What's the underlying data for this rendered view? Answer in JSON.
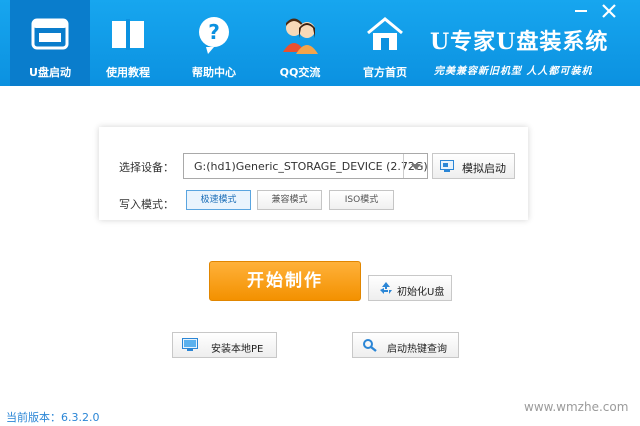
{
  "header": {
    "nav": [
      {
        "label": "U盘启动",
        "icon": "usb-window-icon",
        "active": true
      },
      {
        "label": "使用教程",
        "icon": "book-icon",
        "active": false
      },
      {
        "label": "帮助中心",
        "icon": "help-icon",
        "active": false
      },
      {
        "label": "QQ交流",
        "icon": "qq-users-icon",
        "active": false
      },
      {
        "label": "官方首页",
        "icon": "home-icon",
        "active": false
      }
    ],
    "brand": "U专家U盘装系统",
    "slogan": "完美兼容新旧机型  人人都可装机",
    "window_controls": {
      "minimize_icon": "minimize-icon",
      "close_icon": "close-icon"
    }
  },
  "panel": {
    "device_label": "选择设备：",
    "device_value": "G:(hd1)Generic_STORAGE_DEVICE (2.72G)",
    "simulate_label": "模拟启动",
    "mode_label": "写入模式：",
    "modes": [
      {
        "label": "极速模式",
        "active": true
      },
      {
        "label": "兼容模式",
        "active": false
      },
      {
        "label": "ISO模式",
        "active": false
      }
    ]
  },
  "actions": {
    "start_label": "开始制作",
    "init_label": "初始化U盘",
    "install_pe_label": "安装本地PE",
    "hotkey_label": "启动热键查询"
  },
  "footer": {
    "version": "当前版本：6.3.2.0",
    "watermark": "www.wmzhe.com"
  },
  "colors": {
    "header": "#0b91e0",
    "start_button": "#f39100",
    "version_text": "#2b86d6"
  }
}
